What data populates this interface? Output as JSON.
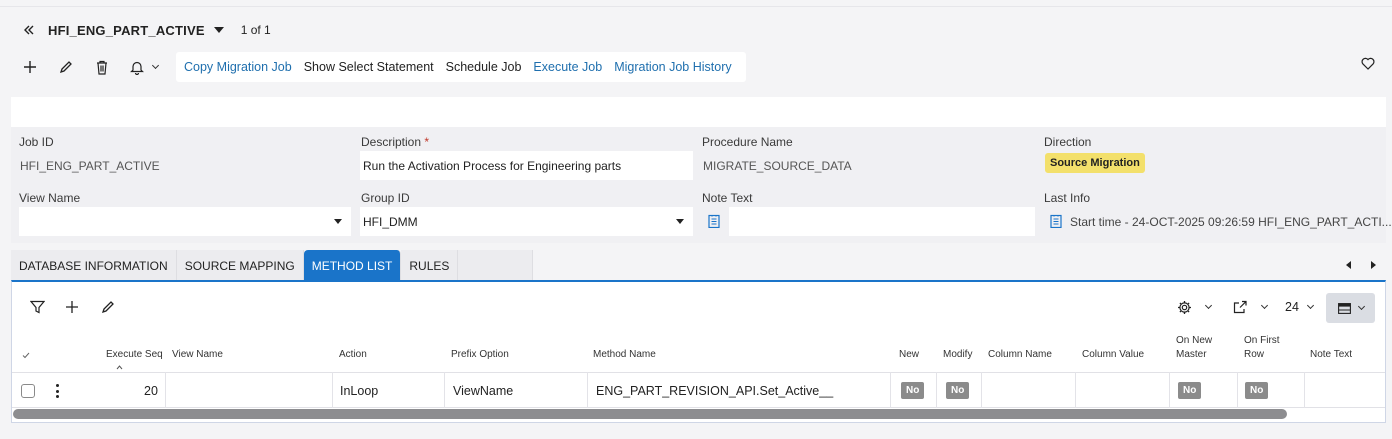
{
  "header": {
    "title": "HFI_ENG_PART_ACTIVE",
    "counter": "1 of 1"
  },
  "toolbar": {
    "commands": [
      {
        "label": "Copy Migration Job"
      },
      {
        "label": "Show Select Statement"
      },
      {
        "label": "Schedule Job"
      },
      {
        "label": "Execute Job"
      },
      {
        "label": "Migration Job History"
      }
    ]
  },
  "form": {
    "job_id": {
      "label": "Job ID",
      "value": "HFI_ENG_PART_ACTIVE"
    },
    "description": {
      "label": "Description",
      "required_mark": "*",
      "value": "Run the Activation Process for Engineering parts"
    },
    "procedure_name": {
      "label": "Procedure Name",
      "value": "MIGRATE_SOURCE_DATA"
    },
    "direction": {
      "label": "Direction",
      "value": "Source Migration"
    },
    "view_name": {
      "label": "View Name",
      "value": ""
    },
    "group_id": {
      "label": "Group ID",
      "value": "HFI_DMM"
    },
    "note_text": {
      "label": "Note Text",
      "value": ""
    },
    "last_info": {
      "label": "Last Info",
      "value": "Start time - 24-OCT-2025 09:26:59   HFI_ENG_PART_ACTI..."
    }
  },
  "tabs": [
    {
      "label": "DATABASE INFORMATION"
    },
    {
      "label": "SOURCE MAPPING"
    },
    {
      "label": "METHOD LIST"
    },
    {
      "label": "RULES"
    }
  ],
  "grid": {
    "page_size": "24",
    "columns": {
      "execute_seq": "Execute Seq",
      "view_name": "View Name",
      "action": "Action",
      "prefix_option": "Prefix Option",
      "method_name": "Method Name",
      "new": "New",
      "modify": "Modify",
      "column_name": "Column Name",
      "column_value": "Column Value",
      "on_new_master_1": "On New",
      "on_new_master_2": "Master",
      "on_first_row_1": "On First",
      "on_first_row_2": "Row",
      "note_text": "Note Text"
    },
    "rows": [
      {
        "execute_seq": "20",
        "view_name": "",
        "action": "InLoop",
        "prefix_option": "ViewName",
        "method_name": "ENG_PART_REVISION_API.Set_Active__",
        "new": "No",
        "modify": "No",
        "column_name": "",
        "column_value": "",
        "on_new_master": "No",
        "on_first_row": "No",
        "note_text": ""
      }
    ]
  },
  "colors": {
    "accent": "#1a74c9",
    "link": "#1f6fae",
    "direction_badge": "#f3e06b",
    "no_badge": "#8b8b8b"
  }
}
